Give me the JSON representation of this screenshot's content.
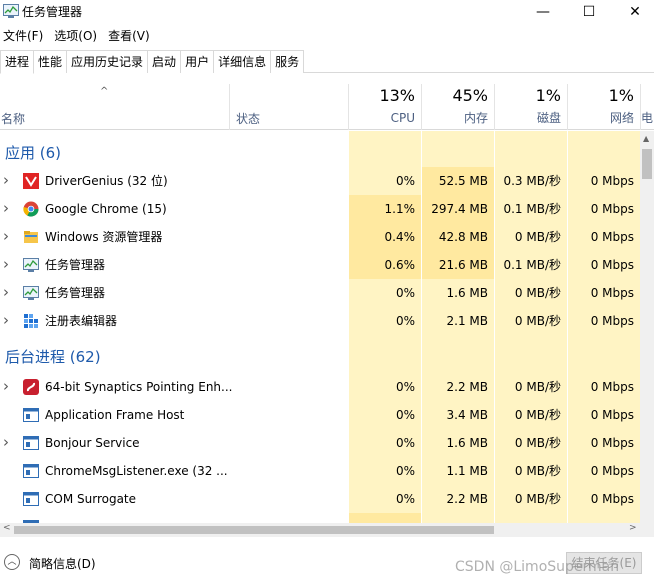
{
  "window": {
    "title": "任务管理器",
    "controls": {
      "minimize": "—",
      "maximize": "☐",
      "close": "✕"
    }
  },
  "menu": [
    "文件(F)",
    "选项(O)",
    "查看(V)"
  ],
  "tabs": [
    "进程",
    "性能",
    "应用历史记录",
    "启动",
    "用户",
    "详细信息",
    "服务"
  ],
  "active_tab": "进程",
  "header": {
    "name": "名称",
    "status": "状态",
    "cpu": {
      "pct": "13%",
      "label": "CPU"
    },
    "memory": {
      "pct": "45%",
      "label": "内存"
    },
    "disk": {
      "pct": "1%",
      "label": "磁盘"
    },
    "network": {
      "pct": "1%",
      "label": "网络"
    },
    "sort_arrow": "^",
    "overflow_label": "电"
  },
  "groups": {
    "apps": "应用 (6)",
    "background": "后台进程 (62)"
  },
  "apps": [
    {
      "name": "DriverGenius (32 位)",
      "icon": "drivergenius-icon",
      "cpu": "0%",
      "mem": "52.5 MB",
      "disk": "0.3 MB/秒",
      "net": "0 Mbps",
      "expandable": true
    },
    {
      "name": "Google Chrome (15)",
      "icon": "chrome-icon",
      "cpu": "1.1%",
      "mem": "297.4 MB",
      "disk": "0.1 MB/秒",
      "net": "0 Mbps",
      "expandable": true
    },
    {
      "name": "Windows 资源管理器",
      "icon": "explorer-icon",
      "cpu": "0.4%",
      "mem": "42.8 MB",
      "disk": "0 MB/秒",
      "net": "0 Mbps",
      "expandable": true
    },
    {
      "name": "任务管理器",
      "icon": "taskmgr-icon",
      "cpu": "0.6%",
      "mem": "21.6 MB",
      "disk": "0.1 MB/秒",
      "net": "0 Mbps",
      "expandable": true
    },
    {
      "name": "任务管理器",
      "icon": "taskmgr-icon",
      "cpu": "0%",
      "mem": "1.6 MB",
      "disk": "0 MB/秒",
      "net": "0 Mbps",
      "expandable": true
    },
    {
      "name": "注册表编辑器",
      "icon": "regedit-icon",
      "cpu": "0%",
      "mem": "2.1 MB",
      "disk": "0 MB/秒",
      "net": "0 Mbps",
      "expandable": true
    }
  ],
  "background": [
    {
      "name": "64-bit Synaptics Pointing Enh...",
      "icon": "synaptics-icon",
      "cpu": "0%",
      "mem": "2.2 MB",
      "disk": "0 MB/秒",
      "net": "0 Mbps",
      "expandable": true
    },
    {
      "name": "Application Frame Host",
      "icon": "app-window-icon",
      "cpu": "0%",
      "mem": "3.4 MB",
      "disk": "0 MB/秒",
      "net": "0 Mbps",
      "expandable": false
    },
    {
      "name": "Bonjour Service",
      "icon": "app-window-icon",
      "cpu": "0%",
      "mem": "1.6 MB",
      "disk": "0 MB/秒",
      "net": "0 Mbps",
      "expandable": true
    },
    {
      "name": "ChromeMsgListener.exe (32 ...",
      "icon": "app-window-icon",
      "cpu": "0%",
      "mem": "1.1 MB",
      "disk": "0 MB/秒",
      "net": "0 Mbps",
      "expandable": false
    },
    {
      "name": "COM Surrogate",
      "icon": "app-window-icon",
      "cpu": "0%",
      "mem": "2.2 MB",
      "disk": "0 MB/秒",
      "net": "0 Mbps",
      "expandable": false
    }
  ],
  "footer": {
    "fewer_details": "简略信息(D)",
    "end_task": "结束任务(E)",
    "watermark": "CSDN @LimoSuperman"
  },
  "colors": {
    "group_title": "#1e5aab",
    "header_label": "#4d6082",
    "heat_light": "#fff4c4",
    "heat_mid": "#ffe9a0"
  }
}
